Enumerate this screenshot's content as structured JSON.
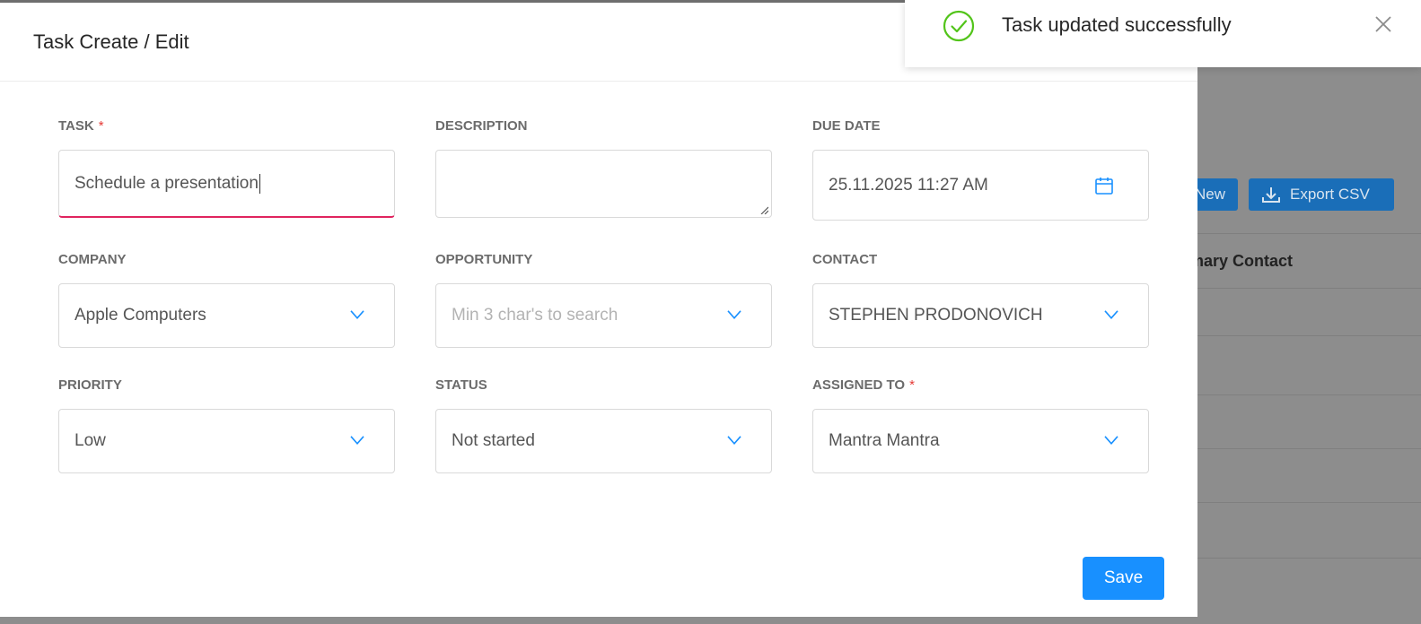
{
  "background": {
    "buttons": {
      "new_label": "New",
      "export_label": "Export CSV"
    },
    "table": {
      "column_header": "imary Contact"
    }
  },
  "modal": {
    "title": "Task Create / Edit",
    "fields": {
      "task": {
        "label": "TASK",
        "required_mark": "*",
        "value": "Schedule a presentation"
      },
      "description": {
        "label": "DESCRIPTION",
        "value": ""
      },
      "due_date": {
        "label": "DUE DATE",
        "value": "25.11.2025 11:27 AM",
        "icon": "calendar-icon"
      },
      "company": {
        "label": "COMPANY",
        "value": "Apple Computers"
      },
      "opportunity": {
        "label": "OPPORTUNITY",
        "placeholder": "Min 3 char's to search"
      },
      "contact": {
        "label": "CONTACT",
        "value": "STEPHEN PRODONOVICH"
      },
      "priority": {
        "label": "PRIORITY",
        "value": "Low"
      },
      "status": {
        "label": "STATUS",
        "value": "Not started"
      },
      "assigned_to": {
        "label": "ASSIGNED TO",
        "required_mark": "*",
        "value": "Mantra Mantra"
      }
    },
    "save_label": "Save"
  },
  "toast": {
    "message": "Task updated successfully",
    "icon": "check-circle-icon",
    "close_icon": "close-icon"
  },
  "colors": {
    "primary": "#1890ff",
    "required": "#e53935",
    "task_underline": "#e0245e",
    "success": "#52c41a",
    "overlay_bg": "#8d8d8d"
  }
}
